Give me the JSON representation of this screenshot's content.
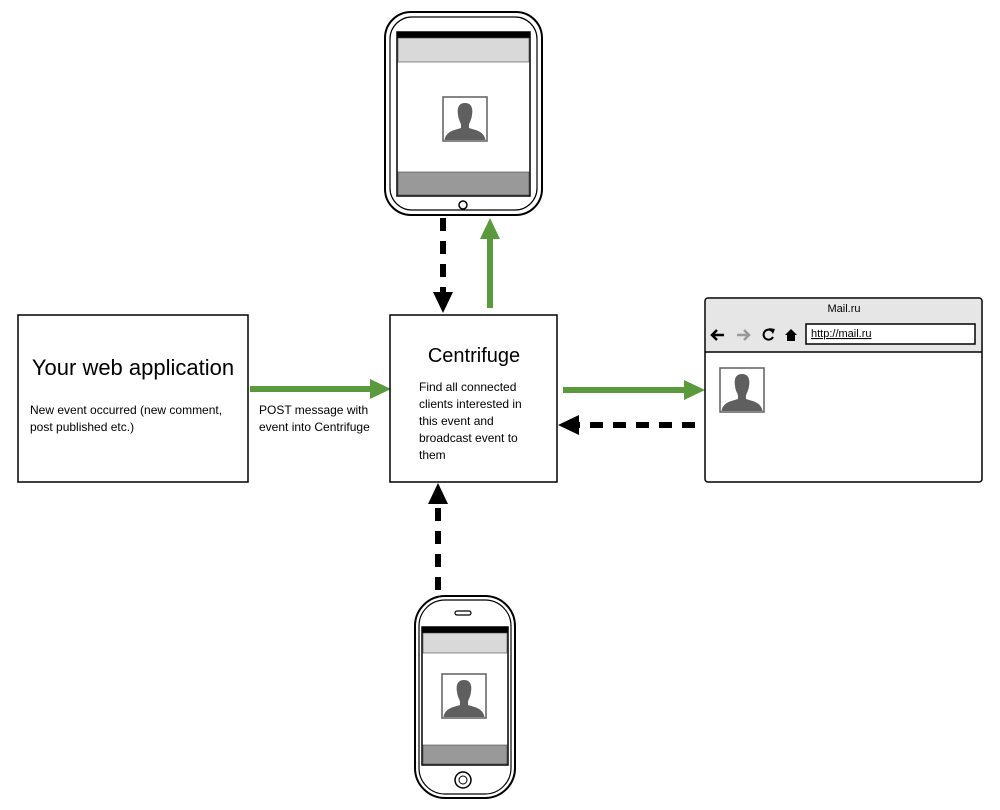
{
  "colors": {
    "push_arrow": "#5b9a3c",
    "request_arrow": "#000000",
    "header_gray": "#e6e6e6",
    "avatar": "#5f5f5f"
  },
  "web_app": {
    "title": "Your web application",
    "lines": [
      "New event occurred (new comment,",
      "post published etc.)"
    ]
  },
  "post_label": {
    "lines": [
      "POST message with",
      "event into Centrifuge"
    ]
  },
  "centrifuge": {
    "title": "Centrifuge",
    "lines": [
      "Find all connected",
      "clients interested in",
      "this event and",
      "broadcast event to",
      "them"
    ]
  },
  "browser": {
    "title": "Mail.ru",
    "url": "http://mail.ru",
    "icons": [
      "back-arrow-icon",
      "forward-arrow-icon",
      "reload-icon",
      "home-icon"
    ]
  },
  "devices": [
    "tablet",
    "browser",
    "phone"
  ]
}
